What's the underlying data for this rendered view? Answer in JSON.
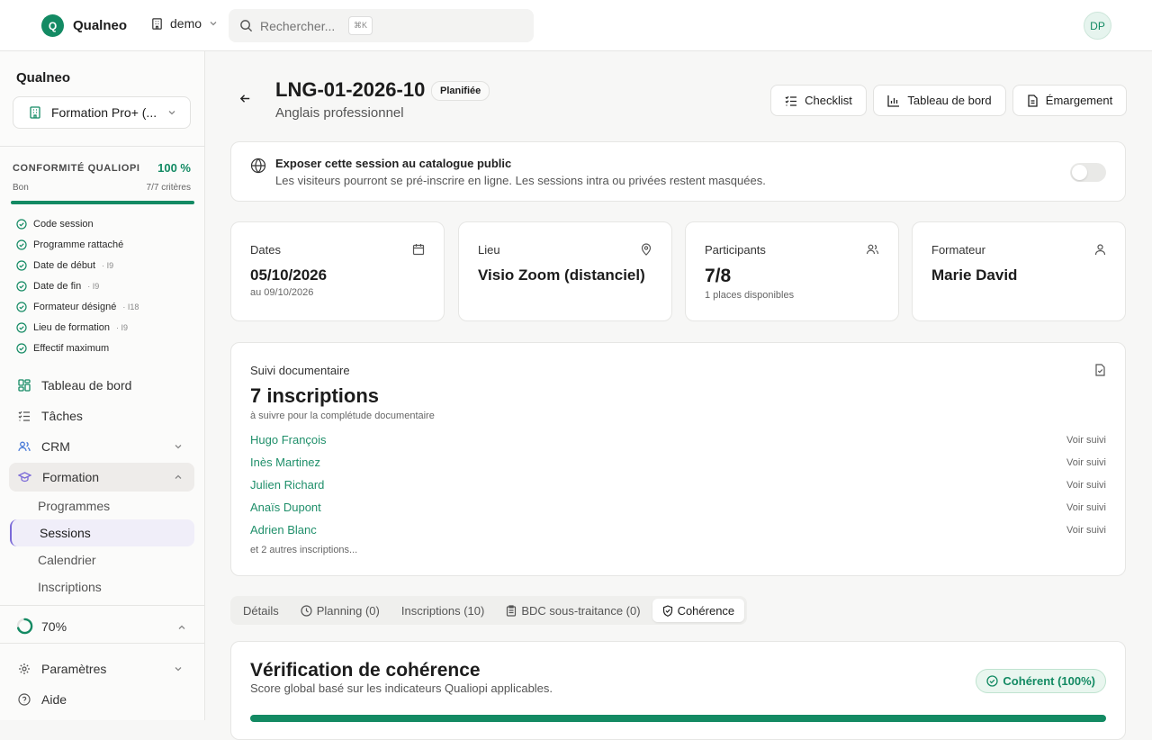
{
  "app": {
    "brand_letter": "Q",
    "brand_name": "Qualneo",
    "org_name": "demo",
    "avatar_initials": "DP"
  },
  "search": {
    "placeholder": "Rechercher...",
    "shortcut": "⌘K"
  },
  "sidebar": {
    "title": "Qualneo",
    "select_value": "Formation Pro+ (...",
    "compliance": {
      "title": "CONFORMITÉ QUALIOPI",
      "percent": "100 %",
      "level": "Bon",
      "criteria_count": "7/7 critères",
      "progress": 1.0,
      "criteria": [
        {
          "label": "Code session",
          "tag": ""
        },
        {
          "label": "Programme rattaché",
          "tag": ""
        },
        {
          "label": "Date de début",
          "tag": "· I9"
        },
        {
          "label": "Date de fin",
          "tag": "· I9"
        },
        {
          "label": "Formateur désigné",
          "tag": "· I18"
        },
        {
          "label": "Lieu de formation",
          "tag": "· I9"
        },
        {
          "label": "Effectif maximum",
          "tag": ""
        }
      ]
    },
    "nav": {
      "dashboard": "Tableau de bord",
      "tasks": "Tâches",
      "crm": "CRM",
      "formation": "Formation",
      "programmes": "Programmes",
      "sessions": "Sessions",
      "calendar": "Calendrier",
      "inscriptions": "Inscriptions",
      "progress_label": "70%",
      "progress_value": 0.7,
      "settings": "Paramètres",
      "help": "Aide"
    }
  },
  "header": {
    "code": "LNG-01-2026-10",
    "status": "Planifiée",
    "subtitle": "Anglais professionnel",
    "buttons": {
      "checklist": "Checklist",
      "dashboard": "Tableau de bord",
      "attendance": "Émargement"
    }
  },
  "expose": {
    "title": "Exposer cette session au catalogue public",
    "description": "Les visiteurs pourront se pré-inscrire en ligne. Les sessions intra ou privées restent masquées.",
    "enabled": false
  },
  "stats": {
    "dates": {
      "label": "Dates",
      "value": "05/10/2026",
      "note": "au 09/10/2026"
    },
    "place": {
      "label": "Lieu",
      "value": "Visio Zoom (distanciel)"
    },
    "participants": {
      "label": "Participants",
      "value": "7/8",
      "note": "1 places disponibles"
    },
    "trainer": {
      "label": "Formateur",
      "value": "Marie David"
    }
  },
  "docs": {
    "label": "Suivi documentaire",
    "count": "7 inscriptions",
    "note": "à suivre pour la complétude documentaire",
    "link_label": "Voir suivi",
    "inscriptions": [
      "Hugo François",
      "Inès Martinez",
      "Julien Richard",
      "Anaïs Dupont",
      "Adrien Blanc"
    ],
    "more": "et 2 autres inscriptions..."
  },
  "tabs": [
    "Détails",
    "Planning (0)",
    "Inscriptions (10)",
    "BDC sous-traitance (0)",
    "Cohérence"
  ],
  "coherence": {
    "title": "Vérification de cohérence",
    "subtitle": "Score global basé sur les indicateurs Qualiopi applicables.",
    "badge": "Cohérent (100%)",
    "score": 1.0
  },
  "colors": {
    "accent": "#138a63",
    "link": "#1f8f6a",
    "formation_accent": "#7b6ad8"
  }
}
